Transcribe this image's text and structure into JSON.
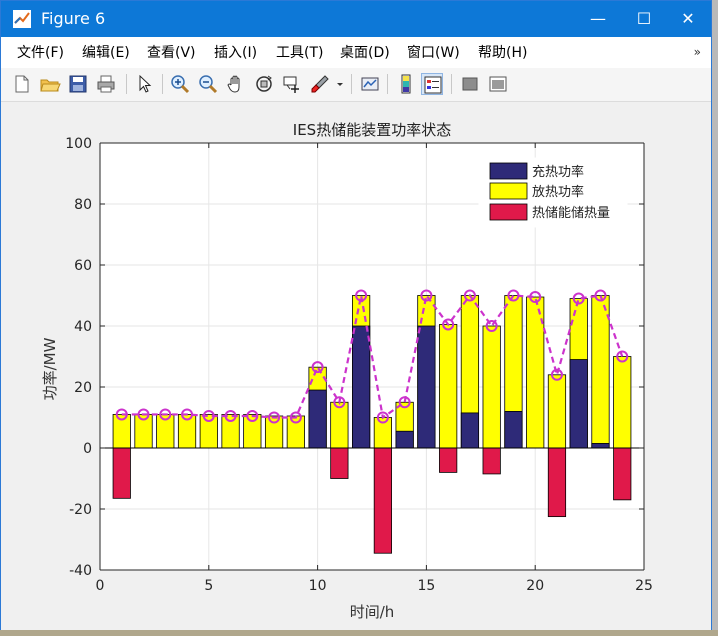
{
  "window": {
    "title": "Figure 6",
    "controls": {
      "minimize": "—",
      "maximize": "☐",
      "close": "✕"
    }
  },
  "menu": [
    {
      "label": "文件(F)"
    },
    {
      "label": "编辑(E)"
    },
    {
      "label": "查看(V)"
    },
    {
      "label": "插入(I)"
    },
    {
      "label": "工具(T)"
    },
    {
      "label": "桌面(D)"
    },
    {
      "label": "窗口(W)"
    },
    {
      "label": "帮助(H)"
    }
  ],
  "menu_overflow": "»",
  "toolbar": [
    {
      "icon": "new-figure-icon"
    },
    {
      "icon": "open-file-icon"
    },
    {
      "icon": "save-icon"
    },
    {
      "icon": "print-icon"
    },
    {
      "icon": "pointer-icon"
    },
    {
      "icon": "zoom-in-icon"
    },
    {
      "icon": "zoom-out-icon"
    },
    {
      "icon": "pan-icon"
    },
    {
      "icon": "rotate-3d-icon"
    },
    {
      "icon": "data-cursor-icon"
    },
    {
      "icon": "brush-icon"
    },
    {
      "icon": "link-plot-icon"
    },
    {
      "icon": "colorbar-icon"
    },
    {
      "icon": "legend-icon"
    },
    {
      "icon": "hide-plot-tools-icon"
    },
    {
      "icon": "show-plot-tools-icon"
    }
  ],
  "colors": {
    "charge": "#2e2a78",
    "discharge": "#ffff00",
    "storage": "#e0194a",
    "line": "#cc33cc",
    "title_bar": "#0d78d7"
  },
  "chart_data": {
    "type": "bar",
    "title": "IES热储能装置功率状态",
    "xlabel": "时间/h",
    "ylabel": "功率/MW",
    "xlim": [
      0,
      25
    ],
    "ylim": [
      -40,
      100
    ],
    "xticks": [
      0,
      5,
      10,
      15,
      20,
      25
    ],
    "yticks": [
      -40,
      -20,
      0,
      20,
      40,
      60,
      80,
      100
    ],
    "grid": true,
    "legend_position": "top-right",
    "x": [
      1,
      2,
      3,
      4,
      5,
      6,
      7,
      8,
      9,
      10,
      11,
      12,
      13,
      14,
      15,
      16,
      17,
      18,
      19,
      20,
      21,
      22,
      23,
      24
    ],
    "series": [
      {
        "name": "充热功率",
        "values": [
          0,
          0,
          0,
          0,
          0,
          0,
          0,
          0,
          0,
          19,
          0,
          40,
          0,
          5.5,
          40,
          0,
          11.5,
          0,
          12,
          0,
          0,
          29,
          1.5,
          0
        ]
      },
      {
        "name": "放热功率",
        "values": [
          11,
          11,
          11,
          11,
          11,
          11,
          11,
          10.5,
          10.5,
          26.5,
          15,
          50,
          10,
          15,
          50,
          40.5,
          50,
          40,
          50,
          49.5,
          24,
          49,
          50,
          30
        ]
      },
      {
        "name": "热储能储热量",
        "values": [
          -16.5,
          0,
          0,
          0,
          0,
          0,
          0,
          0,
          0,
          0,
          -10,
          0,
          -34.5,
          0,
          0,
          -8,
          0,
          -8.5,
          0,
          0,
          -22.5,
          0,
          0,
          -17
        ]
      }
    ],
    "line": {
      "style": "dashed with circle markers",
      "values": [
        11,
        11,
        11,
        11,
        10.5,
        10.5,
        10.5,
        10,
        10,
        26.5,
        15,
        50,
        10,
        15,
        50,
        40.5,
        50,
        40,
        50,
        49.5,
        24,
        49,
        50,
        30
      ]
    }
  }
}
